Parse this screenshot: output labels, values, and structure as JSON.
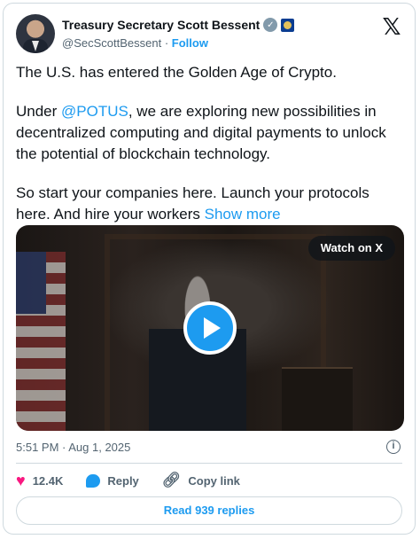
{
  "author": {
    "name": "Treasury Secretary Scott Bessent",
    "handle": "@SecScottBessent",
    "separator": "·",
    "follow_label": "Follow",
    "verified_badge": "verified-gray-icon",
    "affiliate_badge": "treasury-seal-icon"
  },
  "tweet": {
    "line1": "The U.S. has entered the Golden Age of Crypto.",
    "para2_prefix": "Under ",
    "mention": "@POTUS",
    "para2_suffix": ", we are exploring new possibilities in decentralized computing and digital payments to unlock the potential of blockchain technology.",
    "para3": "So start your companies here. Launch your protocols here. And hire your workers ",
    "show_more": "Show more"
  },
  "media": {
    "watch_label": "Watch on X"
  },
  "meta": {
    "timestamp": "5:51 PM · Aug 1, 2025"
  },
  "actions": {
    "likes": "12.4K",
    "reply_label": "Reply",
    "copy_label": "Copy link"
  },
  "read_replies": "Read 939 replies",
  "colors": {
    "accent": "#1d9bf0",
    "like": "#f91880",
    "text": "#0f1419",
    "secondary": "#536471"
  }
}
